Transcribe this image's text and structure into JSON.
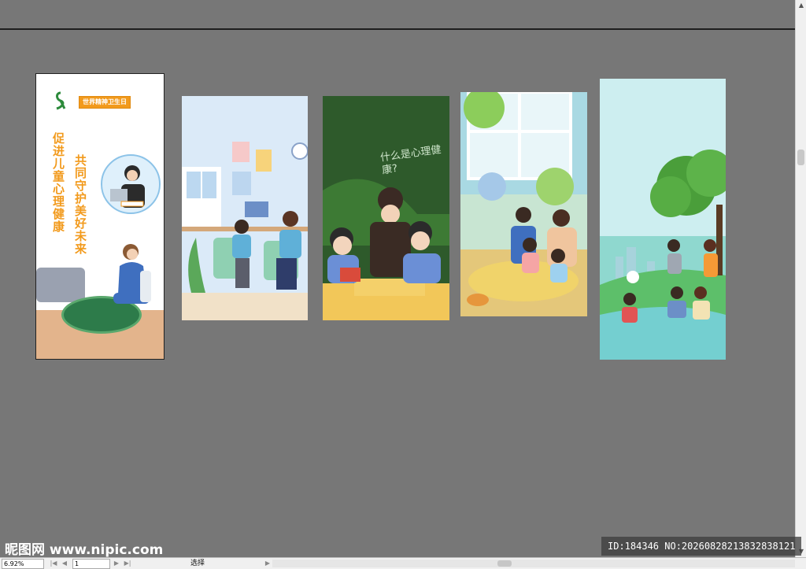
{
  "artboard1": {
    "banner": "世界精神卫生日",
    "slogan_left": "促进儿童心理健康",
    "slogan_right": "共同守护美好未来"
  },
  "artboard3": {
    "chalk_text": "什么是心理健康?"
  },
  "statusbar": {
    "zoom": "6.92%",
    "page": "1",
    "tool": "选择"
  },
  "watermark": {
    "site": "昵图网 www.nipic.com",
    "id": "ID:184346 NO:20260828213832838121"
  },
  "colors": {
    "canvas": "#777777",
    "accent_orange": "#f29a1c"
  },
  "icons": [
    "ribbon-icon",
    "first-page-icon",
    "prev-page-icon",
    "next-page-icon",
    "last-page-icon",
    "scroll-arrow-icon"
  ]
}
